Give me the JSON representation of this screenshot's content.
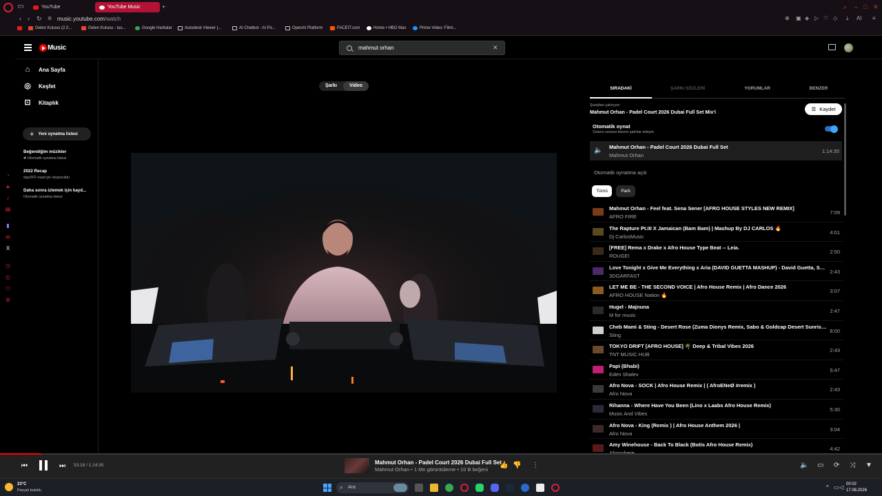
{
  "browser": {
    "tabs": [
      {
        "label": "YouTube",
        "active": false
      },
      {
        "label": "YouTube Music",
        "active": true
      }
    ],
    "url_host": "music.youtube.com",
    "url_path": "/watch",
    "bookmarks": [
      {
        "label": "Gelen Kutusu (2.0...",
        "color": "#ea4335"
      },
      {
        "label": "Gelen Kutusu - tas...",
        "color": "#ea4335"
      },
      {
        "label": "Google Haritalar",
        "color": "#34a853"
      },
      {
        "label": "Autodesk Viewer |...",
        "color": "#cccccc"
      },
      {
        "label": "AI Chatbot - AI Po...",
        "color": "#cccccc"
      },
      {
        "label": "OpenAI Platform",
        "color": "#cccccc"
      },
      {
        "label": "FACEIT.com",
        "color": "#ff5500"
      },
      {
        "label": "Home • HBO Max",
        "color": "#ffffff"
      },
      {
        "label": "Prime Video: Filmi...",
        "color": "#1a98ff"
      }
    ]
  },
  "header": {
    "logo_text": "Music",
    "search_value": "mahmut orhan"
  },
  "nav": {
    "items": [
      {
        "label": "Ana Sayfa",
        "icon": "home-icon"
      },
      {
        "label": "Keşfet",
        "icon": "compass-icon"
      },
      {
        "label": "Kitaplık",
        "icon": "library-icon"
      }
    ],
    "new_playlist": "Yeni oynatma listesi",
    "playlists": [
      {
        "title": "Beğendiğim müzikler",
        "sub": "✱ Otomatik oynatma listesi"
      },
      {
        "title": "2022 Recap",
        "sub": "dayOFF-road için oluşturuldu"
      },
      {
        "title": "Daha sonra izlemek için kayd...",
        "sub": "Otomatik oynatma listesi"
      }
    ]
  },
  "video_toggle": {
    "song": "Şarkı",
    "video": "Video"
  },
  "panel": {
    "tabs": [
      "SIRADAKİ",
      "ŞARKI SÖZLERİ",
      "YORUMLAR",
      "BENZER"
    ],
    "playing_from_label": "Şuradan çalınıyor:",
    "set_title": "Mahmut Orhan - Padel Court 2026 Dubai Full Set Mix'i",
    "save_label": "Kaydet",
    "autoplay_title": "Otomatik oynat",
    "autoplay_sub": "Sıranın sonuna benzer şarkılar ekleyin.",
    "autoplay_enabled": true,
    "current": {
      "title": "Mahmut Orhan - Padel Court 2026 Dubai Full Set",
      "artist": "Mahmut Orhan",
      "duration": "1:14:35"
    },
    "autoplay_on": "Otomatik oynatma açık",
    "chips": [
      "Tümü",
      "Parti"
    ],
    "queue": [
      {
        "title": "Mahmut Orhan - Feel feat. Sena Sener [AFRO HOUSE STYLES NEW REMIX]",
        "artist": "AFRO FIRE",
        "duration": "7:09",
        "color": "#7a3b1a"
      },
      {
        "title": "The Rapture Pt.III X Jamaican (Bam Bam) | Mashup By DJ CARLOS 🔥",
        "artist": "Dj CarlosMusic",
        "duration": "4:01",
        "color": "#5a4a20"
      },
      {
        "title": "[FREE] Rema x Drake x Afro House Type Beat -- Leia.",
        "artist": "ROUGE!",
        "duration": "2:50",
        "color": "#3a2a1a"
      },
      {
        "title": "Love Tonight x Give Me Everything x Aria (DAVID GUETTA MASHUP) - David Guetta, Sh...",
        "artist": "3DGARFAST",
        "duration": "2:43",
        "color": "#4a2a6a"
      },
      {
        "title": "LET ME BE - THE SECOND VOICE | Afro House Remix | Afro Dance 2026",
        "artist": "AFRO HOUSE Nation 🔥",
        "duration": "3:07",
        "color": "#8a5a20"
      },
      {
        "title": "Hugel - Majnuna",
        "artist": "M for music",
        "duration": "2:47",
        "color": "#2a2a2a"
      },
      {
        "title": "Cheb Mami & Sting - Desert Rose (Zuma Dionys Remix, Sabo & Goldcap Desert Sunrise...",
        "artist": "Sting",
        "duration": "8:00",
        "color": "#d0d0d0"
      },
      {
        "title": "TOKYO DRIFT [AFRO HOUSE] 🌴 Deep & Tribal Vibes 2026",
        "artist": "TNT MUSIC HUB",
        "duration": "2:43",
        "color": "#6a4a2a"
      },
      {
        "title": "Papi (Bhabi)",
        "artist": "Eden Shalev",
        "duration": "5:47",
        "color": "#c02070"
      },
      {
        "title": "Afro Nova - SOCK | Afro House Remix | ( AfroENeØ #remix )",
        "artist": "Afro Nova",
        "duration": "2:43",
        "color": "#3a3a3a"
      },
      {
        "title": "Rihanna - Where Have You Been (Lino x Laabs Afro House Remix)",
        "artist": "Music And Vibes",
        "duration": "5:30",
        "color": "#2a2a3a"
      },
      {
        "title": "Afro Nova - King (Remix ) | Afro House Anthem 2026 |",
        "artist": "Afro Nova",
        "duration": "3:04",
        "color": "#3a2a2a"
      },
      {
        "title": "Amy Winehouse - Back To Black (Botis Afro House Remix)",
        "artist": "Afrosphere",
        "duration": "4:42",
        "color": "#5a1a1a"
      }
    ]
  },
  "player": {
    "time": "53:18 / 1:14:35",
    "progress": 0.047,
    "title": "Mahmut Orhan - Padel Court 2026 Dubai Full Set",
    "subtitle": "Mahmut Orhan • 1 Mn görüntüleme • 10 B beğeni"
  },
  "taskbar": {
    "weather_temp": "23°C",
    "weather_desc": "Parçalı bulutlu",
    "search_label": "Ara",
    "time": "00:02",
    "date": "17.08.2026"
  },
  "colors": {
    "accent": "#ff0000",
    "toggle": "#3ea6ff",
    "opera": "#d8203c"
  }
}
